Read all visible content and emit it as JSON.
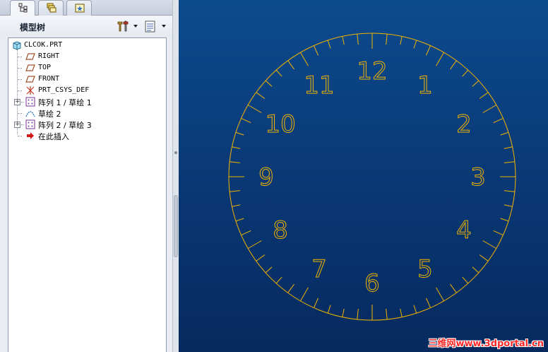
{
  "panel": {
    "tabs": [
      {
        "name": "model-tree-tab-icon"
      },
      {
        "name": "layers-tab-icon"
      },
      {
        "name": "favorites-tab-icon"
      }
    ],
    "title": "模型树",
    "settings_icon": "tools-icon",
    "columns_icon": "list-icon"
  },
  "tree": {
    "items": [
      {
        "label": "CLCOK.PRT",
        "icon": "part-icon",
        "expandable": false
      },
      {
        "label": "RIGHT",
        "icon": "datum-plane-icon",
        "expandable": false
      },
      {
        "label": "TOP",
        "icon": "datum-plane-icon",
        "expandable": false
      },
      {
        "label": "FRONT",
        "icon": "datum-plane-icon",
        "expandable": false
      },
      {
        "label": "PRT_CSYS_DEF",
        "icon": "csys-icon",
        "expandable": false
      },
      {
        "label": "阵列 1 / 草绘 1",
        "icon": "pattern-icon",
        "expandable": true
      },
      {
        "label": "草绘 2",
        "icon": "sketch-icon",
        "expandable": false
      },
      {
        "label": "阵列 2 / 草绘 3",
        "icon": "pattern-icon",
        "expandable": true
      },
      {
        "label": "在此插入",
        "icon": "insert-arrow-icon",
        "expandable": false
      }
    ]
  },
  "clock": {
    "numerals": [
      "12",
      "1",
      "2",
      "3",
      "4",
      "5",
      "6",
      "7",
      "8",
      "9",
      "10",
      "11"
    ],
    "tick_count": 60,
    "line_color": "#f0b400"
  },
  "watermark": "三维网www.3dportal.cn",
  "colors": {
    "viewport_top": "#0c4b8e",
    "viewport_bottom": "#062a5e",
    "accent": "#f0b400"
  }
}
